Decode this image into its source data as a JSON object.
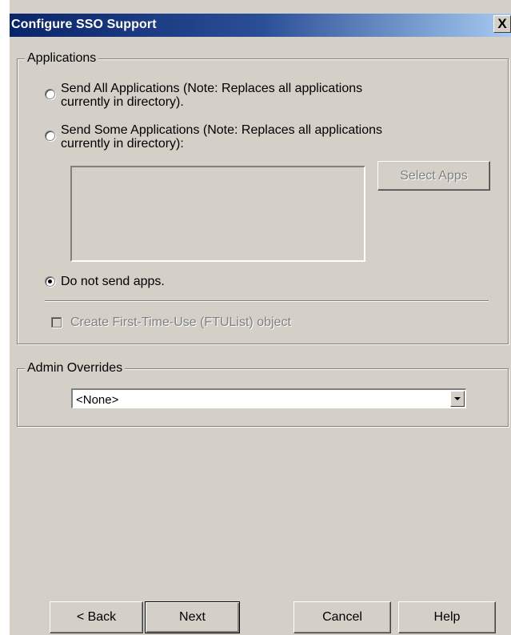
{
  "window": {
    "title": "Configure SSO Support",
    "close_glyph": "X"
  },
  "applications": {
    "legend": "Applications",
    "options": [
      {
        "line1": "Send All Applications (Note: Replaces all applications",
        "line2": "currently in directory).",
        "selected": false
      },
      {
        "line1": "Send Some Applications (Note: Replaces all applications",
        "line2": "currently in directory):",
        "selected": false
      },
      {
        "line1": "Do not send apps.",
        "selected": true
      }
    ],
    "select_apps_label": "Select Apps",
    "select_apps_enabled": false,
    "ftu_checkbox_label": "Create First-Time-Use (FTUList) object",
    "ftu_checkbox_checked": false,
    "ftu_checkbox_enabled": false
  },
  "admin_overrides": {
    "legend": "Admin Overrides",
    "selected_value": "<None>"
  },
  "footer": {
    "back_label": "< Back",
    "next_label": "Next",
    "cancel_label": "Cancel",
    "help_label": "Help"
  },
  "icons": {
    "close": "close-icon",
    "combo_arrow": "chevron-down-icon"
  }
}
